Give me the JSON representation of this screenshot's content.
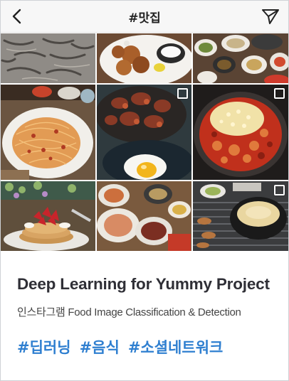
{
  "header": {
    "title": "#맛집",
    "back_icon": "chevron-left-icon",
    "share_icon": "paper-plane-icon"
  },
  "photos": [
    {
      "subject": "grilled shrimp on a platter"
    },
    {
      "subject": "fried chicken with dipping sauce"
    },
    {
      "subject": "table of side dishes"
    },
    {
      "subject": "spaghetti with tomato sauce"
    },
    {
      "subject": "braised octopus with fried egg",
      "multi_image": true
    },
    {
      "subject": "cheese-topped spicy stew in a pan",
      "multi_image": true
    },
    {
      "subject": "strawberry pancake stack"
    },
    {
      "subject": "table spread of dishes"
    },
    {
      "subject": "charcoal grill with soup bowl",
      "multi_image": true
    }
  ],
  "caption": {
    "headline": "Deep Learning for Yummy Project",
    "subtitle": "인스타그램 Food Image Classification & Detection",
    "hashtags": [
      "#딥러닝",
      "#음식",
      "#소셜네트워크"
    ]
  },
  "colors": {
    "accent": "#2f7fd0",
    "headline": "#2f2f36",
    "topbar": "#f7f7f7"
  }
}
